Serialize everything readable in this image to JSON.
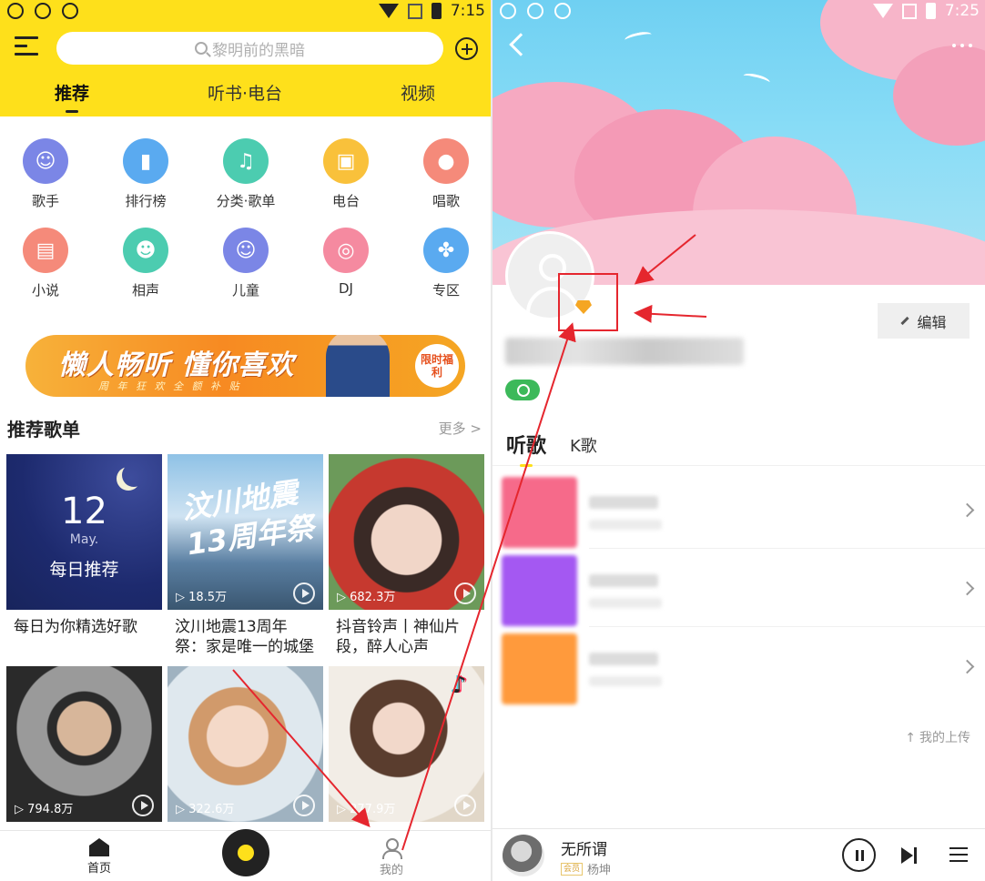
{
  "left": {
    "status": {
      "time": "7:15"
    },
    "search": {
      "placeholder": "黎明前的黑暗"
    },
    "tabs": [
      {
        "label": "推荐"
      },
      {
        "label": "听书·电台"
      },
      {
        "label": "视频"
      }
    ],
    "categories": [
      {
        "label": "歌手",
        "icon": "singer-icon",
        "color": "#7b86e6"
      },
      {
        "label": "排行榜",
        "icon": "chart-icon",
        "color": "#5aaaf0"
      },
      {
        "label": "分类·歌单",
        "icon": "playlist-icon",
        "color": "#4cccb0"
      },
      {
        "label": "电台",
        "icon": "radio-icon",
        "color": "#f9c13b"
      },
      {
        "label": "唱歌",
        "icon": "microphone-icon",
        "color": "#f58a7a"
      },
      {
        "label": "小说",
        "icon": "book-icon",
        "color": "#f58a7a"
      },
      {
        "label": "相声",
        "icon": "mask-icon",
        "color": "#4cccb0"
      },
      {
        "label": "儿童",
        "icon": "baby-icon",
        "color": "#7b86e6"
      },
      {
        "label": "DJ",
        "icon": "dj-icon",
        "color": "#f58aa0"
      },
      {
        "label": "专区",
        "icon": "grid-icon",
        "color": "#5aaaf0"
      }
    ],
    "banner": {
      "title": "懒人畅听 懂你喜欢",
      "subtitle": "周 年 狂 欢    全 额 补 贴",
      "badge": "限时福利"
    },
    "section": {
      "title": "推荐歌单",
      "more": "更多 >"
    },
    "playlists": [
      {
        "caption": "每日为你精选好歌",
        "plays": "",
        "day": "12",
        "month": "May.",
        "label": "每日推荐"
      },
      {
        "caption": "汶川地震13周年祭：家是唯一的城堡",
        "plays": "▷ 18.5万"
      },
      {
        "caption": "抖音铃声丨神仙片段，醉人心声",
        "plays": "▷ 682.3万"
      },
      {
        "caption": "",
        "plays": "▷ 794.8万"
      },
      {
        "caption": "",
        "plays": "▷ 322.6万"
      },
      {
        "caption": "",
        "plays": "▷ 277.9万"
      }
    ],
    "nav": {
      "home": "首页",
      "mine": "我的"
    }
  },
  "right": {
    "status": {
      "time": "7:25"
    },
    "edit": "编辑",
    "tabs": [
      {
        "label": "听歌"
      },
      {
        "label": "K歌"
      }
    ],
    "upload": "我的上传",
    "player": {
      "song": "无所谓",
      "artist": "杨坤",
      "vip": "会员"
    }
  },
  "colors": {
    "brand_yellow": "#fee01b",
    "arrow_red": "#e5262e"
  }
}
